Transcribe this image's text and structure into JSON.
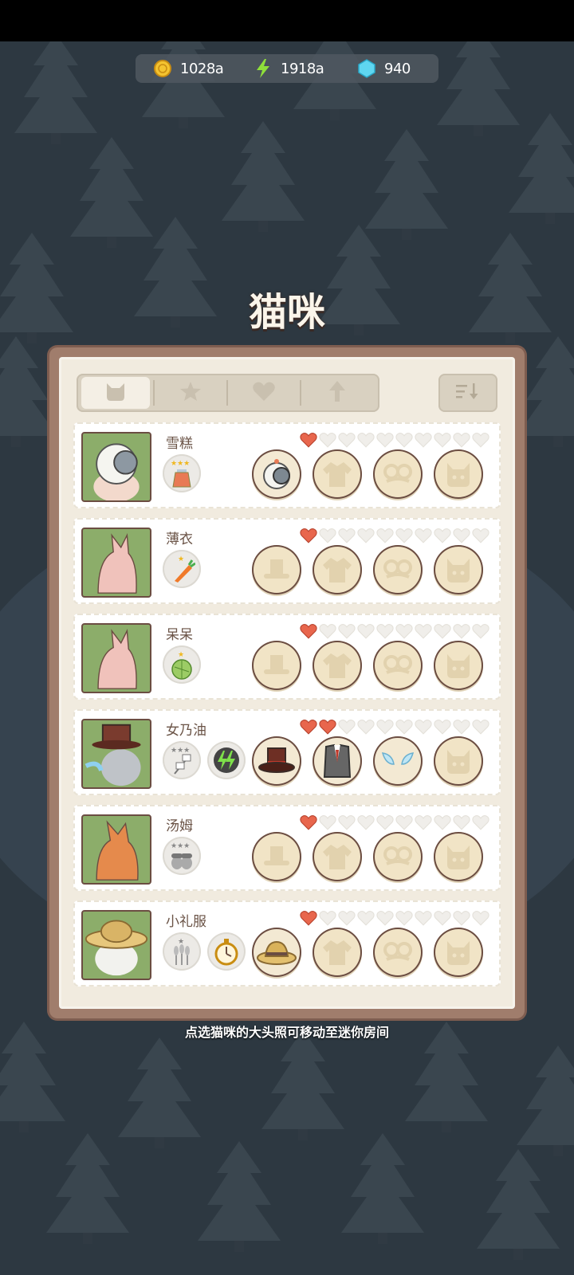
{
  "currency": {
    "coins": "1028a",
    "energy": "1918a",
    "gems": "940",
    "icons": [
      "coin-icon",
      "lightning-icon",
      "gem-icon"
    ]
  },
  "title": "猫咪",
  "tabs": [
    {
      "icon": "cat-head-icon",
      "active": true
    },
    {
      "icon": "star-icon",
      "active": false
    },
    {
      "icon": "heart-icon",
      "active": false
    },
    {
      "icon": "up-arrow-icon",
      "active": false
    }
  ],
  "sort_icon": "sort-icon",
  "cats": [
    {
      "name": "雪糕",
      "hearts_filled": 1,
      "hearts_total": 10,
      "skills": [
        "potion-3star"
      ],
      "equipped": [
        "helmet",
        "",
        "",
        ""
      ]
    },
    {
      "name": "薄衣",
      "hearts_filled": 1,
      "hearts_total": 10,
      "skills": [
        "carrot-1star"
      ],
      "equipped": [
        "",
        "",
        "",
        ""
      ]
    },
    {
      "name": "呆呆",
      "hearts_filled": 1,
      "hearts_total": 10,
      "skills": [
        "cabbage-1star"
      ],
      "equipped": [
        "",
        "",
        "",
        ""
      ]
    },
    {
      "name": "女乃油",
      "hearts_filled": 2,
      "hearts_total": 10,
      "skills": [
        "marshmallow-3star",
        "double-energy"
      ],
      "equipped": [
        "top-hat",
        "vest",
        "wings",
        ""
      ]
    },
    {
      "name": "汤姆",
      "hearts_filled": 1,
      "hearts_total": 10,
      "skills": [
        "acorn-3star"
      ],
      "equipped": [
        "",
        "",
        "",
        ""
      ]
    },
    {
      "name": "小礼服",
      "hearts_filled": 1,
      "hearts_total": 10,
      "skills": [
        "wheat-1star",
        "stopwatch"
      ],
      "equipped": [
        "straw-hat",
        "",
        "",
        ""
      ]
    }
  ],
  "hint": "点选猫咪的大头照可移动至迷你房间",
  "colors": {
    "heart_filled": "#e8664d",
    "heart_empty": "#f0eeea",
    "panel_frame": "#a07d6c"
  }
}
